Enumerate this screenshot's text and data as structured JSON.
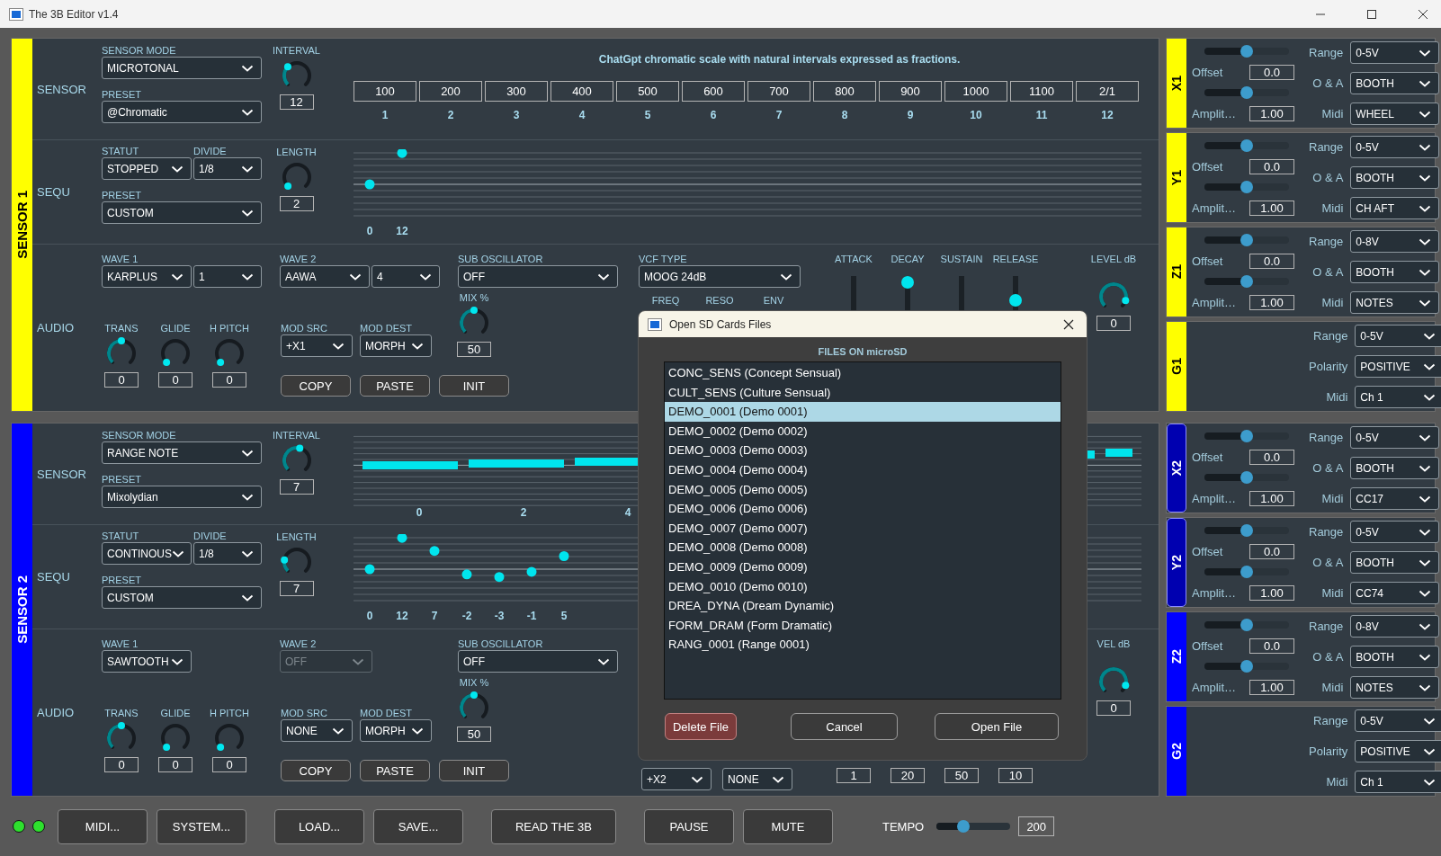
{
  "window": {
    "title": "The 3B Editor v1.4"
  },
  "sensors": [
    {
      "title": "SENSOR 1",
      "color": "#ffff00",
      "sensor": {
        "label": "SENSOR",
        "mode": {
          "label": "SENSOR MODE",
          "value": "MICROTONAL"
        },
        "preset": {
          "label": "PRESET",
          "value": "@Chromatic"
        },
        "interval": {
          "label": "INTERVAL",
          "value": "12",
          "level": 0.33
        },
        "display": {
          "kind": "intervals",
          "caption": "ChatGpt chromatic scale with natural intervals expressed as fractions.",
          "cells": [
            {
              "value": "100",
              "index": "1"
            },
            {
              "value": "200",
              "index": "2"
            },
            {
              "value": "300",
              "index": "3"
            },
            {
              "value": "400",
              "index": "4"
            },
            {
              "value": "500",
              "index": "5"
            },
            {
              "value": "600",
              "index": "6"
            },
            {
              "value": "700",
              "index": "7"
            },
            {
              "value": "800",
              "index": "8"
            },
            {
              "value": "900",
              "index": "9"
            },
            {
              "value": "1000",
              "index": "10"
            },
            {
              "value": "1100",
              "index": "11"
            },
            {
              "value": "2/1",
              "index": "12"
            }
          ]
        }
      },
      "sequ": {
        "label": "SEQU",
        "statut": {
          "label": "STATUT",
          "value": "STOPPED"
        },
        "divide": {
          "label": "DIVIDE",
          "value": "1/8"
        },
        "preset": {
          "label": "PRESET",
          "value": "CUSTOM"
        },
        "length": {
          "label": "LENGTH",
          "value": "2",
          "level": 0
        },
        "steps": [
          "0",
          "12"
        ]
      },
      "audio": {
        "label": "AUDIO",
        "wave1": {
          "label": "WAVE 1",
          "value": "KARPLUS",
          "option": "1"
        },
        "wave2": {
          "label": "WAVE 2",
          "value": "AAWA",
          "option": "4",
          "disabled": false
        },
        "sub_osc": {
          "label": "SUB OSCILLATOR",
          "value": "OFF"
        },
        "knobs": [
          {
            "label": "TRANS",
            "value": "0",
            "level": 0.5
          },
          {
            "label": "GLIDE",
            "value": "0",
            "level": 0
          },
          {
            "label": "H PITCH",
            "value": "0",
            "level": 0
          }
        ],
        "mod_src": {
          "label": "MOD SRC",
          "value": "+X1"
        },
        "mod_dest": {
          "label": "MOD DEST",
          "value": "MORPH"
        },
        "mix": {
          "label": "MIX %",
          "value": "50",
          "level": 0.5
        },
        "buttons": [
          "COPY",
          "PASTE",
          "INIT"
        ],
        "vcf": {
          "label": "VCF TYPE",
          "value": "MOOG 24dB",
          "controls": [
            "FREQ",
            "RESO",
            "ENV"
          ]
        },
        "envelope": [
          {
            "label": "ATTACK"
          },
          {
            "label": "DECAY",
            "level": 1
          },
          {
            "label": "SUSTAIN"
          },
          {
            "label": "RELEASE",
            "level": 0.56
          }
        ],
        "level_db": {
          "label": "LEVEL dB",
          "value": "0",
          "level": 0.9
        }
      }
    },
    {
      "title": "SENSOR 2",
      "color": "#0000ff",
      "sensor": {
        "label": "SENSOR",
        "mode": {
          "label": "SENSOR MODE",
          "value": "RANGE NOTE"
        },
        "preset": {
          "label": "PRESET",
          "value": "Mixolydian"
        },
        "interval": {
          "label": "INTERVAL",
          "value": "7",
          "level": 0.55
        },
        "display": {
          "kind": "ranges",
          "axis": [
            "0",
            "2",
            "4"
          ]
        }
      },
      "sequ": {
        "label": "SEQU",
        "statut": {
          "label": "STATUT",
          "value": "CONTINOUS"
        },
        "divide": {
          "label": "DIVIDE",
          "value": "1/8"
        },
        "preset": {
          "label": "PRESET",
          "value": "CUSTOM"
        },
        "length": {
          "label": "LENGTH",
          "value": "7",
          "level": 0.2
        },
        "steps": [
          "0",
          "12",
          "7",
          "-2",
          "-3",
          "-1",
          "5"
        ]
      },
      "audio": {
        "label": "AUDIO",
        "wave1": {
          "label": "WAVE 1",
          "value": "SAWTOOTH"
        },
        "wave2": {
          "label": "WAVE 2",
          "value": "OFF",
          "disabled": true
        },
        "sub_osc": {
          "label": "SUB OSCILLATOR",
          "value": "OFF"
        },
        "knobs": [
          {
            "label": "TRANS",
            "value": "0",
            "level": 0.5
          },
          {
            "label": "GLIDE",
            "value": "0",
            "level": 0
          },
          {
            "label": "H PITCH",
            "value": "0",
            "level": 0
          }
        ],
        "mod_src": {
          "label": "MOD SRC",
          "value": "NONE"
        },
        "mod_dest": {
          "label": "MOD DEST",
          "value": "MORPH"
        },
        "mix": {
          "label": "MIX %",
          "value": "50",
          "level": 0.5
        },
        "buttons": [
          "COPY",
          "PASTE",
          "INIT"
        ],
        "level_db": {
          "label": "VEL dB",
          "value": "0",
          "level": 0.9
        },
        "mod_freq": {
          "value": "+X2"
        },
        "mod_reso": {
          "value": "NONE"
        },
        "envelope_values": [
          "1",
          "20",
          "50",
          "10"
        ]
      }
    }
  ],
  "input_groups": [
    {
      "cards": [
        {
          "name": "X1",
          "color": "#ffff00",
          "active": false,
          "kind": "axis",
          "offset": {
            "label": "Offset",
            "value": "0.0",
            "level": 0.5
          },
          "amplitude": {
            "label": "Amplit…",
            "value": "1.00",
            "level": 0.5
          },
          "selects": [
            {
              "label": "Range",
              "value": "0-5V"
            },
            {
              "label": "O & A",
              "value": "BOOTH"
            },
            {
              "label": "Midi",
              "value": "WHEEL"
            }
          ]
        },
        {
          "name": "Y1",
          "color": "#ffff00",
          "active": false,
          "kind": "axis",
          "offset": {
            "label": "Offset",
            "value": "0.0",
            "level": 0.5
          },
          "amplitude": {
            "label": "Amplit…",
            "value": "1.00",
            "level": 0.5
          },
          "selects": [
            {
              "label": "Range",
              "value": "0-5V"
            },
            {
              "label": "O & A",
              "value": "BOOTH"
            },
            {
              "label": "Midi",
              "value": "CH AFT"
            }
          ]
        },
        {
          "name": "Z1",
          "color": "#ffff00",
          "active": false,
          "kind": "axis",
          "offset": {
            "label": "Offset",
            "value": "0.0",
            "level": 0.5
          },
          "amplitude": {
            "label": "Amplit…",
            "value": "1.00",
            "level": 0.5
          },
          "selects": [
            {
              "label": "Range",
              "value": "0-8V"
            },
            {
              "label": "O & A",
              "value": "BOOTH"
            },
            {
              "label": "Midi",
              "value": "NOTES"
            }
          ]
        },
        {
          "name": "G1",
          "color": "#ffff00",
          "active": false,
          "kind": "gate",
          "selects": [
            {
              "label": "Range",
              "value": "0-5V"
            },
            {
              "label": "Polarity",
              "value": "POSITIVE"
            },
            {
              "label": "Midi",
              "value": "Ch 1"
            }
          ]
        }
      ]
    },
    {
      "cards": [
        {
          "name": "X2",
          "color": "#0000b0",
          "active": true,
          "kind": "axis",
          "offset": {
            "label": "Offset",
            "value": "0.0",
            "level": 0.5
          },
          "amplitude": {
            "label": "Amplit…",
            "value": "1.00",
            "level": 0.5
          },
          "selects": [
            {
              "label": "Range",
              "value": "0-5V"
            },
            {
              "label": "O & A",
              "value": "BOOTH"
            },
            {
              "label": "Midi",
              "value": "CC17"
            }
          ]
        },
        {
          "name": "Y2",
          "color": "#0000b0",
          "active": true,
          "kind": "axis",
          "offset": {
            "label": "Offset",
            "value": "0.0",
            "level": 0.5
          },
          "amplitude": {
            "label": "Amplit…",
            "value": "1.00",
            "level": 0.5
          },
          "selects": [
            {
              "label": "Range",
              "value": "0-5V"
            },
            {
              "label": "O & A",
              "value": "BOOTH"
            },
            {
              "label": "Midi",
              "value": "CC74"
            }
          ]
        },
        {
          "name": "Z2",
          "color": "#0000ff",
          "active": false,
          "kind": "axis",
          "offset": {
            "label": "Offset",
            "value": "0.0",
            "level": 0.5
          },
          "amplitude": {
            "label": "Amplit…",
            "value": "1.00",
            "level": 0.5
          },
          "selects": [
            {
              "label": "Range",
              "value": "0-8V"
            },
            {
              "label": "O & A",
              "value": "BOOTH"
            },
            {
              "label": "Midi",
              "value": "NOTES"
            }
          ]
        },
        {
          "name": "G2",
          "color": "#0000ff",
          "active": false,
          "kind": "gate",
          "selects": [
            {
              "label": "Range",
              "value": "0-5V"
            },
            {
              "label": "Polarity",
              "value": "POSITIVE"
            },
            {
              "label": "Midi",
              "value": "Ch 1"
            }
          ]
        }
      ]
    }
  ],
  "footer": {
    "leds": [
      {
        "on": true
      },
      {
        "on": true
      }
    ],
    "button_groups": [
      [
        "MIDI...",
        "SYSTEM..."
      ],
      [
        "LOAD...",
        "SAVE..."
      ],
      [
        "READ THE 3B"
      ],
      [
        "PAUSE",
        "MUTE"
      ]
    ],
    "tempo": {
      "label": "TEMPO",
      "value": "200",
      "level": 0.33
    }
  },
  "dialog": {
    "title": "Open SD Cards Files",
    "heading": "FILES ON microSD",
    "files": [
      {
        "name": "CONC_SENS (Concept Sensual)",
        "selected": false
      },
      {
        "name": "CULT_SENS (Culture Sensual)",
        "selected": false
      },
      {
        "name": "DEMO_0001 (Demo 0001)",
        "selected": true
      },
      {
        "name": "DEMO_0002 (Demo 0002)",
        "selected": false
      },
      {
        "name": "DEMO_0003 (Demo 0003)",
        "selected": false
      },
      {
        "name": "DEMO_0004 (Demo 0004)",
        "selected": false
      },
      {
        "name": "DEMO_0005 (Demo 0005)",
        "selected": false
      },
      {
        "name": "DEMO_0006 (Demo 0006)",
        "selected": false
      },
      {
        "name": "DEMO_0007 (Demo 0007)",
        "selected": false
      },
      {
        "name": "DEMO_0008 (Demo 0008)",
        "selected": false
      },
      {
        "name": "DEMO_0009 (Demo 0009)",
        "selected": false
      },
      {
        "name": "DEMO_0010 (Demo 0010)",
        "selected": false
      },
      {
        "name": "DREA_DYNA (Dream Dynamic)",
        "selected": false
      },
      {
        "name": "FORM_DRAM (Form Dramatic)",
        "selected": false
      },
      {
        "name": "RANG_0001 (Range 0001)",
        "selected": false
      }
    ],
    "buttons": [
      {
        "label": "Delete File",
        "kind": "danger"
      },
      {
        "label": "Cancel",
        "kind": "normal"
      },
      {
        "label": "Open File",
        "kind": "normal"
      }
    ]
  }
}
